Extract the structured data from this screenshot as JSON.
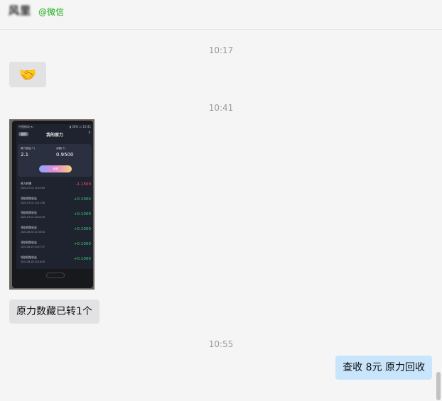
{
  "header": {
    "contact_name": "风里",
    "contact_source": "@微信"
  },
  "messages": [
    {
      "type": "time",
      "text": "10:17"
    },
    {
      "type": "emoji",
      "side": "left",
      "emoji": "🤝"
    },
    {
      "type": "time",
      "text": "10:41"
    },
    {
      "type": "image",
      "side": "left",
      "phone": {
        "status_left": "中国移动 ▾ᵢₗ",
        "status_right": "▮ 58% ▭ 10:41",
        "back": "返回",
        "title": "我的原力",
        "help": "?",
        "card": {
          "label_1": "原力收益(个)",
          "value_1": "2.1",
          "label_2": "余额(个)",
          "value_2": "0.9500",
          "button": "转赠"
        },
        "rows": [
          {
            "label": "原力转赠",
            "date": "2022-07-02 10:43:09",
            "amount": "-1.1500",
            "negative": true
          },
          {
            "label": "领取视频收益",
            "date": "2022-07-02 10:11:58",
            "amount": "+0.1000",
            "negative": false
          },
          {
            "label": "领取视频收益",
            "date": "2022-07-01 20:42:39",
            "amount": "+0.1000",
            "negative": false
          },
          {
            "label": "领取视频收益",
            "date": "2022-06-30 21:30:44",
            "amount": "+0.1000",
            "negative": false
          },
          {
            "label": "领取视频收益",
            "date": "2022-06-29 20:27:37",
            "amount": "+0.1000",
            "negative": false
          },
          {
            "label": "领取视频收益",
            "date": "2022-06-28 20:18:29",
            "amount": "+0.1000",
            "negative": false
          }
        ]
      }
    },
    {
      "type": "text",
      "side": "left",
      "text": "原力数藏已转1个"
    },
    {
      "type": "time",
      "text": "10:55"
    },
    {
      "type": "text",
      "side": "right",
      "text": "查收 8元 原力回收"
    }
  ],
  "colors": {
    "background": "#f5f5f5",
    "bubble_left": "#e2e2e4",
    "bubble_right": "#c9e5fc",
    "source_green": "#1aad19",
    "timestamp": "#9b9b9b"
  }
}
